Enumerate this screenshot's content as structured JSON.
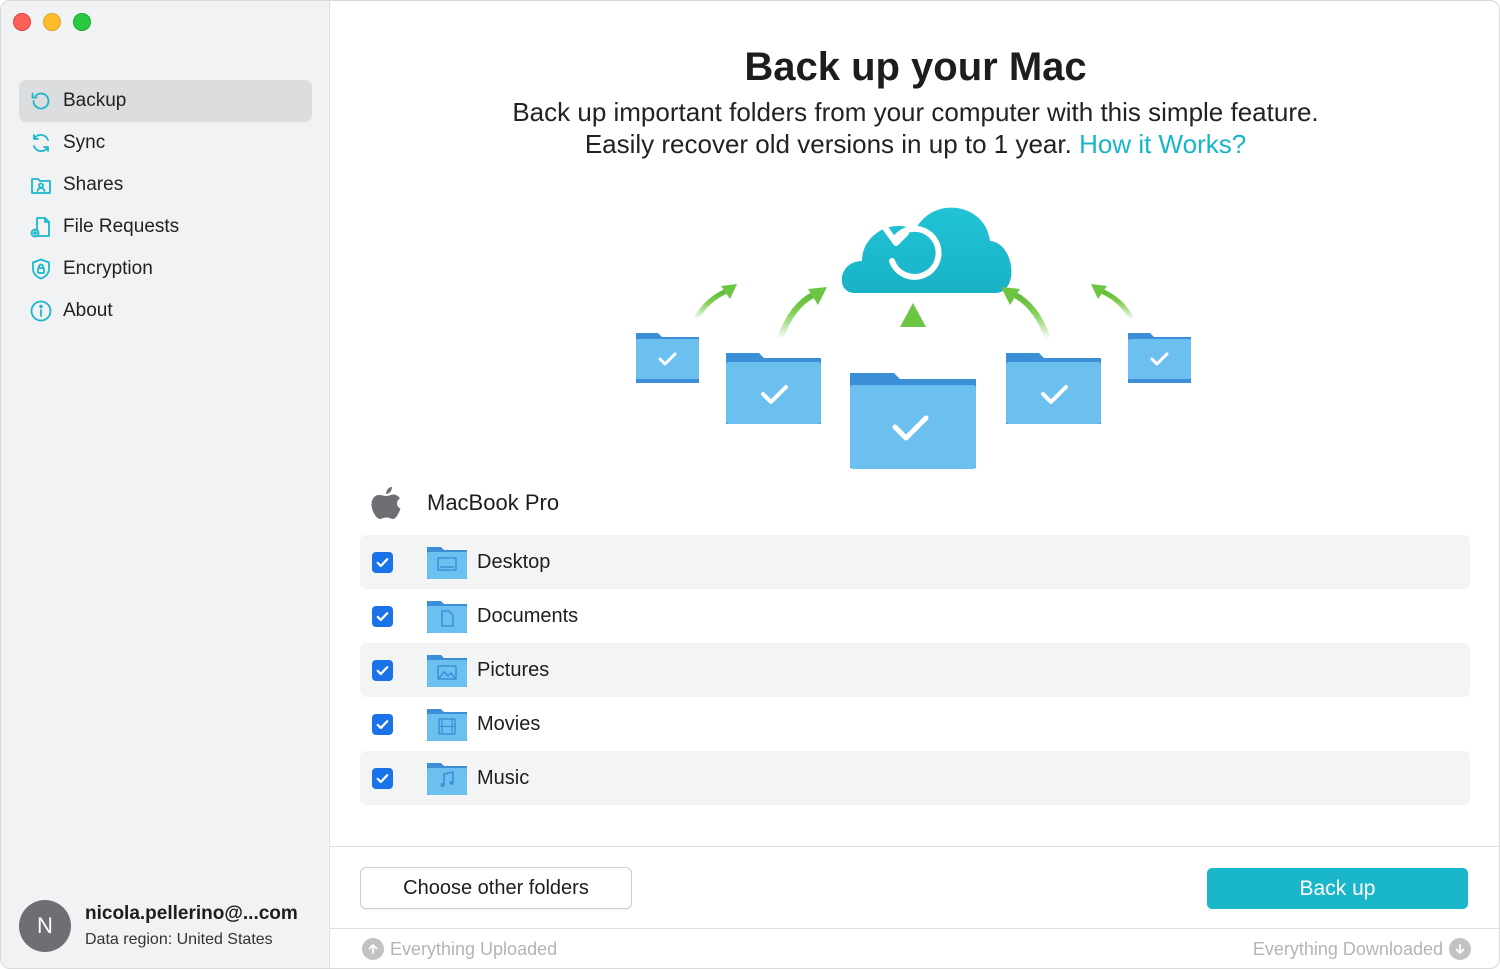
{
  "window": {
    "controls": [
      "close",
      "minimize",
      "zoom"
    ]
  },
  "sidebar": {
    "items": [
      {
        "label": "Backup",
        "icon": "backup-icon",
        "active": true
      },
      {
        "label": "Sync",
        "icon": "sync-icon",
        "active": false
      },
      {
        "label": "Shares",
        "icon": "shares-icon",
        "active": false
      },
      {
        "label": "File Requests",
        "icon": "file-request-icon",
        "active": false
      },
      {
        "label": "Encryption",
        "icon": "lock-shield-icon",
        "active": false
      },
      {
        "label": "About",
        "icon": "info-icon",
        "active": false
      }
    ],
    "account": {
      "initial": "N",
      "email": "nicola.pellerino@...com",
      "region": "Data region: United States"
    }
  },
  "main": {
    "title": "Back up your Mac",
    "subtitle_line1": "Back up important folders from your computer with this simple feature.",
    "subtitle_line2": "Easily recover old versions in up to 1 year.",
    "link": "How it Works?",
    "device": "MacBook Pro",
    "folders": [
      {
        "label": "Desktop",
        "checked": true,
        "icon": "desktop-folder-icon"
      },
      {
        "label": "Documents",
        "checked": true,
        "icon": "documents-folder-icon"
      },
      {
        "label": "Pictures",
        "checked": true,
        "icon": "pictures-folder-icon"
      },
      {
        "label": "Movies",
        "checked": true,
        "icon": "movies-folder-icon"
      },
      {
        "label": "Music",
        "checked": true,
        "icon": "music-folder-icon"
      }
    ],
    "choose_button": "Choose other folders",
    "backup_button": "Back up"
  },
  "status": {
    "uploaded": "Everything Uploaded",
    "downloaded": "Everything Downloaded"
  },
  "colors": {
    "accent": "#1ab7cb",
    "link": "#17b5c9",
    "checkbox": "#1a73e8",
    "folder": "#5ab4e8",
    "arrow": "#6cc644"
  }
}
